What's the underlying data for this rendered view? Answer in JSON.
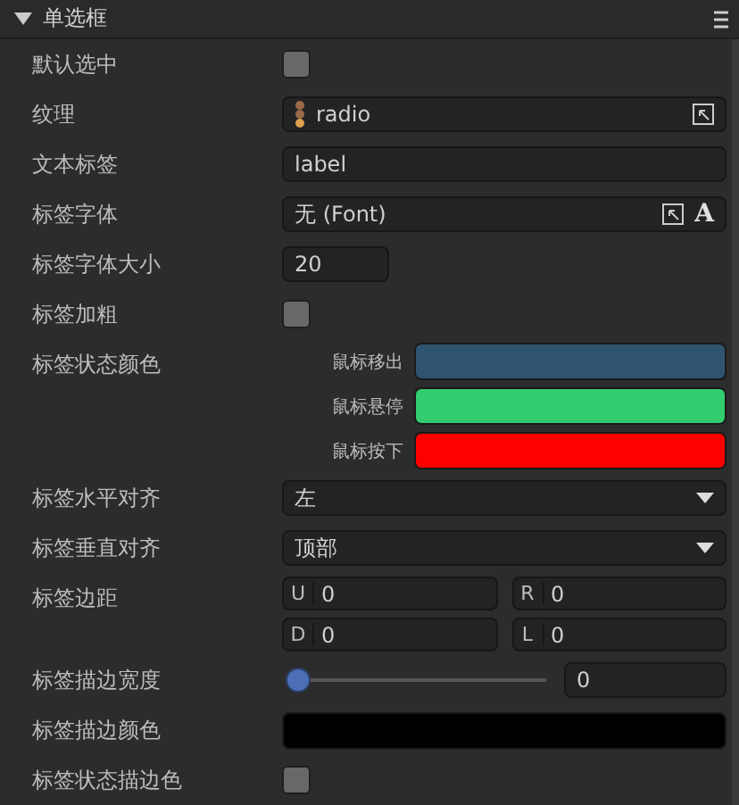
{
  "panel": {
    "title": "单选框",
    "expanded": true
  },
  "properties": [
    {
      "kind": "checkbox",
      "label": "默认选中",
      "checked": false
    },
    {
      "kind": "asset",
      "label": "纹理",
      "value": "radio"
    },
    {
      "kind": "text",
      "label": "文本标签",
      "value": "label"
    },
    {
      "kind": "font",
      "label": "标签字体",
      "value": "无 (Font)",
      "button": "A"
    },
    {
      "kind": "number",
      "label": "标签字体大小",
      "value": "20"
    },
    {
      "kind": "checkbox",
      "label": "标签加粗",
      "checked": false
    },
    {
      "kind": "state_colors",
      "label": "标签状态颜色",
      "states": [
        {
          "label": "鼠标移出",
          "color": "#2f5470"
        },
        {
          "label": "鼠标悬停",
          "color": "#33cc6e"
        },
        {
          "label": "鼠标按下",
          "color": "#ff0000"
        }
      ]
    },
    {
      "kind": "select",
      "label": "标签水平对齐",
      "value": "左"
    },
    {
      "kind": "select",
      "label": "标签垂直对齐",
      "value": "顶部"
    },
    {
      "kind": "margins",
      "label": "标签边距",
      "fields": [
        {
          "key": "U",
          "value": "0"
        },
        {
          "key": "R",
          "value": "0"
        },
        {
          "key": "D",
          "value": "0"
        },
        {
          "key": "L",
          "value": "0"
        }
      ]
    },
    {
      "kind": "slider",
      "label": "标签描边宽度",
      "level": 0,
      "value": "0"
    },
    {
      "kind": "color",
      "label": "标签描边颜色",
      "color": "#000000"
    },
    {
      "kind": "checkbox",
      "label": "标签状态描边色",
      "checked": false
    }
  ]
}
